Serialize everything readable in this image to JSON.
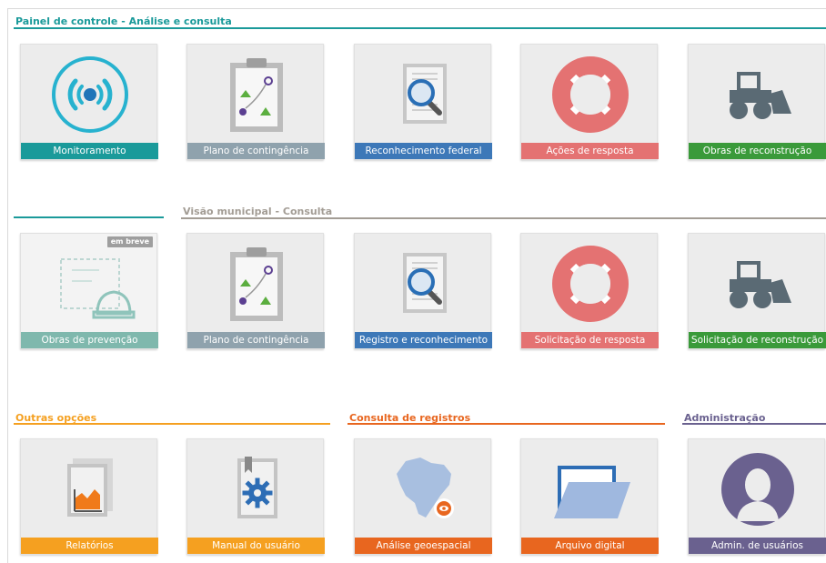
{
  "colors": {
    "teal": "#1a9a9a",
    "slate": "#8fa2ad",
    "blue": "#3d78b8",
    "salmon": "#e47272",
    "green": "#3a9a3a",
    "light_teal": "#7fb8ad",
    "orange": "#f5a020",
    "dark_orange": "#e8661f",
    "purple": "#6a618f",
    "taupe": "#a39d95"
  },
  "sections": {
    "painel": {
      "title": "Painel de controle - Análise e consulta"
    },
    "visao": {
      "title": "Visão municipal - Consulta"
    },
    "outras": {
      "title": "Outras opções"
    },
    "consulta": {
      "title": "Consulta de registros"
    },
    "admin": {
      "title": "Administração"
    }
  },
  "row1": [
    {
      "label": "Monitoramento",
      "icon": "radar-icon"
    },
    {
      "label": "Plano de contingência",
      "icon": "clipboard-plan-icon"
    },
    {
      "label": "Reconhecimento federal",
      "icon": "document-search-icon"
    },
    {
      "label": "Ações de resposta",
      "icon": "lifebuoy-icon"
    },
    {
      "label": "Obras de reconstrução",
      "icon": "bulldozer-icon"
    }
  ],
  "row2": [
    {
      "label": "Obras de prevenção",
      "icon": "blueprint-helmet-icon",
      "badge": "em breve"
    },
    {
      "label": "Plano de contingência",
      "icon": "clipboard-plan-icon"
    },
    {
      "label": "Registro e reconhecimento",
      "icon": "document-search-icon"
    },
    {
      "label": "Solicitação de resposta",
      "icon": "lifebuoy-icon"
    },
    {
      "label": "Solicitação de reconstrução",
      "icon": "bulldozer-icon"
    }
  ],
  "row3": [
    {
      "label": "Relatórios",
      "icon": "report-chart-icon"
    },
    {
      "label": "Manual do usuário",
      "icon": "manual-gear-icon"
    },
    {
      "label": "Análise geoespacial",
      "icon": "brazil-map-icon"
    },
    {
      "label": "Arquivo digital",
      "icon": "folder-icon"
    },
    {
      "label": "Admin. de usuários",
      "icon": "user-avatar-icon"
    }
  ]
}
